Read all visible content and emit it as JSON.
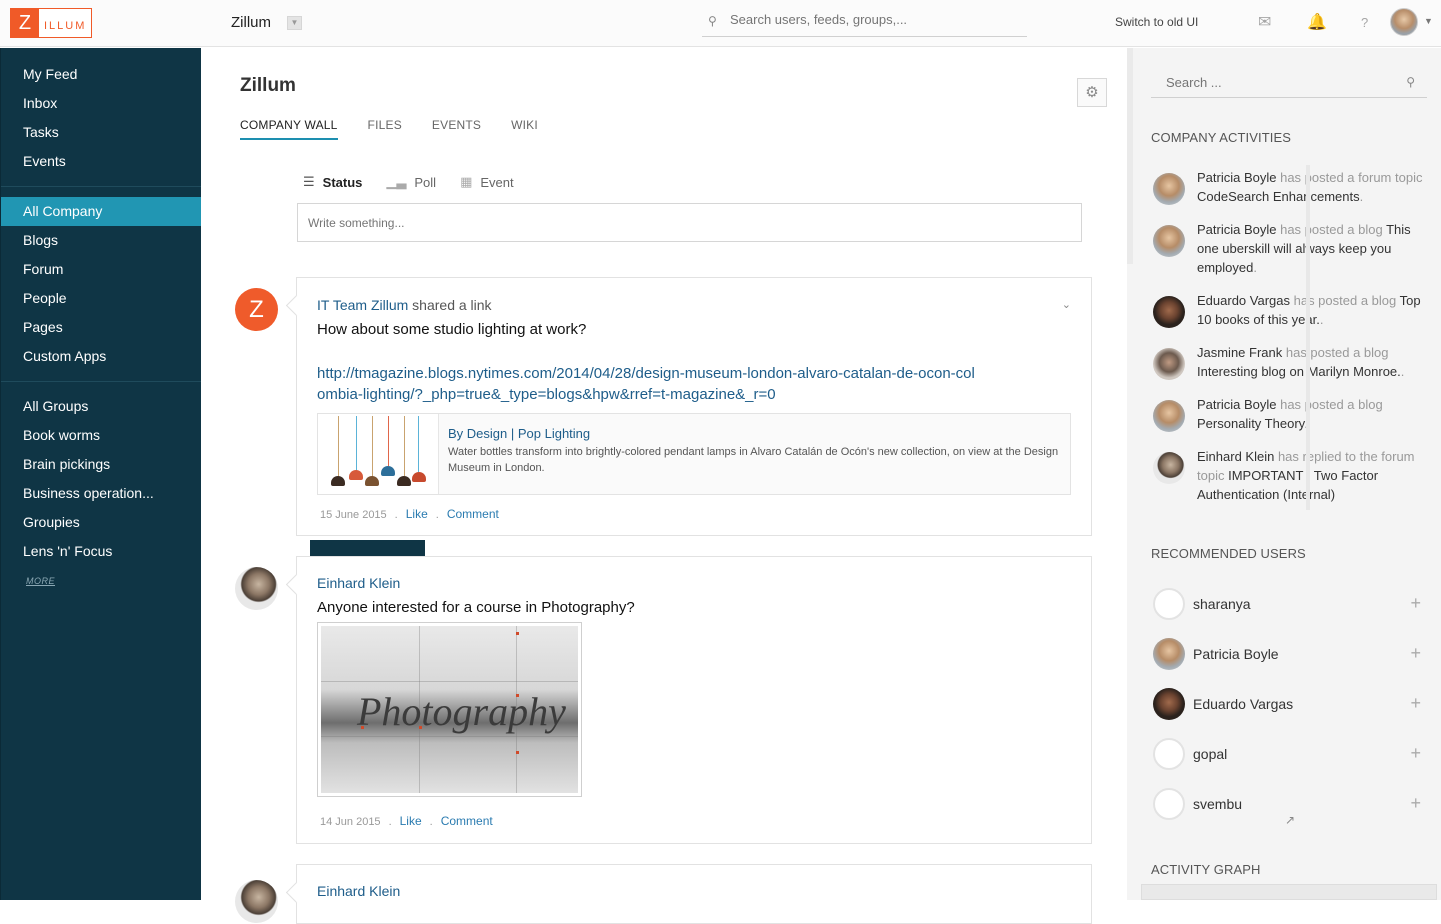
{
  "topbar": {
    "logo_letter": "Z",
    "logo_text": "ILLUM",
    "org_name": "Zillum",
    "search_placeholder": "Search users, feeds, groups,...",
    "switch_ui": "Switch to old UI",
    "icons": [
      "mail-icon",
      "bell-icon",
      "help-icon"
    ],
    "help_symbol": "?"
  },
  "sidebar": {
    "primary": [
      {
        "label": "My Feed"
      },
      {
        "label": "Inbox"
      },
      {
        "label": "Tasks"
      },
      {
        "label": "Events"
      }
    ],
    "company": [
      {
        "label": "All Company",
        "active": true
      },
      {
        "label": "Blogs"
      },
      {
        "label": "Forum"
      },
      {
        "label": "People"
      },
      {
        "label": "Pages"
      },
      {
        "label": "Custom Apps"
      }
    ],
    "groups": [
      {
        "label": "All Groups"
      },
      {
        "label": "Book worms"
      },
      {
        "label": "Brain pickings"
      },
      {
        "label": "Business operation..."
      },
      {
        "label": "Groupies"
      },
      {
        "label": "Lens 'n' Focus"
      }
    ],
    "more": "MORE"
  },
  "main": {
    "title": "Zillum",
    "tabs": [
      {
        "label": "COMPANY WALL",
        "active": true
      },
      {
        "label": "FILES"
      },
      {
        "label": "EVENTS"
      },
      {
        "label": "WIKI"
      }
    ],
    "composer": {
      "types": [
        {
          "label": "Status",
          "icon": "status-icon",
          "active": true
        },
        {
          "label": "Poll",
          "icon": "poll-icon"
        },
        {
          "label": "Event",
          "icon": "calendar-icon"
        }
      ],
      "placeholder": "Write something..."
    },
    "posts": [
      {
        "avatar_letter": "Z",
        "author": "IT Team Zillum",
        "action": " shared a link",
        "text": "How about some studio lighting at work?",
        "link": "http://tmagazine.blogs.nytimes.com/2014/04/28/design-museum-london-alvaro-catalan-de-ocon-colombia-lighting/?_php=true&_type=blogs&hpw&rref=t-magazine&_r=0",
        "card_title": "By Design | Pop Lighting",
        "card_desc": "Water bottles transform into brightly-colored pendant lamps in Alvaro Catalán de Ocón's new collection, on view at the Design Museum in London.",
        "date": "15 June 2015",
        "like": "Like",
        "comment": "Comment"
      },
      {
        "author": "Einhard Klein",
        "text": "Anyone interested for a course in Photography?",
        "photo_word": "Photography",
        "date": "14 Jun 2015",
        "like": "Like",
        "comment": "Comment"
      },
      {
        "author": "Einhard Klein"
      }
    ],
    "dot": "."
  },
  "right": {
    "search_placeholder": "Search ...",
    "activities_heading": "COMPANY ACTIVITIES",
    "activities": [
      {
        "name": "Patricia Boyle",
        "verb": " has posted a forum topic ",
        "object": "CodeSearch Enhancements",
        "tail": "."
      },
      {
        "name": "Patricia Boyle",
        "verb": " has posted a blog ",
        "object": "This one uberskill will always keep you employed",
        "tail": "."
      },
      {
        "name": "Eduardo Vargas",
        "verb": " has posted a blog ",
        "object": "Top 10 books of this year.",
        "tail": "."
      },
      {
        "name": "Jasmine Frank",
        "verb": " has posted a blog ",
        "object": "Interesting blog on Marilyn Monroe.",
        "tail": "."
      },
      {
        "name": "Patricia Boyle",
        "verb": " has posted a blog ",
        "object": "Personality Theory",
        "tail": "."
      },
      {
        "name": "Einhard Klein",
        "verb": " has replied to the forum topic ",
        "object": "IMPORTANT : Two Factor Authentication (Internal)",
        "tail": ""
      }
    ],
    "recommended_heading": "RECOMMENDED USERS",
    "recommended": [
      {
        "name": "sharanya"
      },
      {
        "name": "Patricia Boyle"
      },
      {
        "name": "Eduardo Vargas"
      },
      {
        "name": "gopal"
      },
      {
        "name": "svembu"
      }
    ],
    "graph_heading": "ACTIVITY GRAPH",
    "plus": "+"
  },
  "colors": {
    "sidebar_bg": "#0f3545",
    "sidebar_active": "#2196b3",
    "brand_orange": "#f05a28",
    "link_blue": "#1e5d8a"
  }
}
